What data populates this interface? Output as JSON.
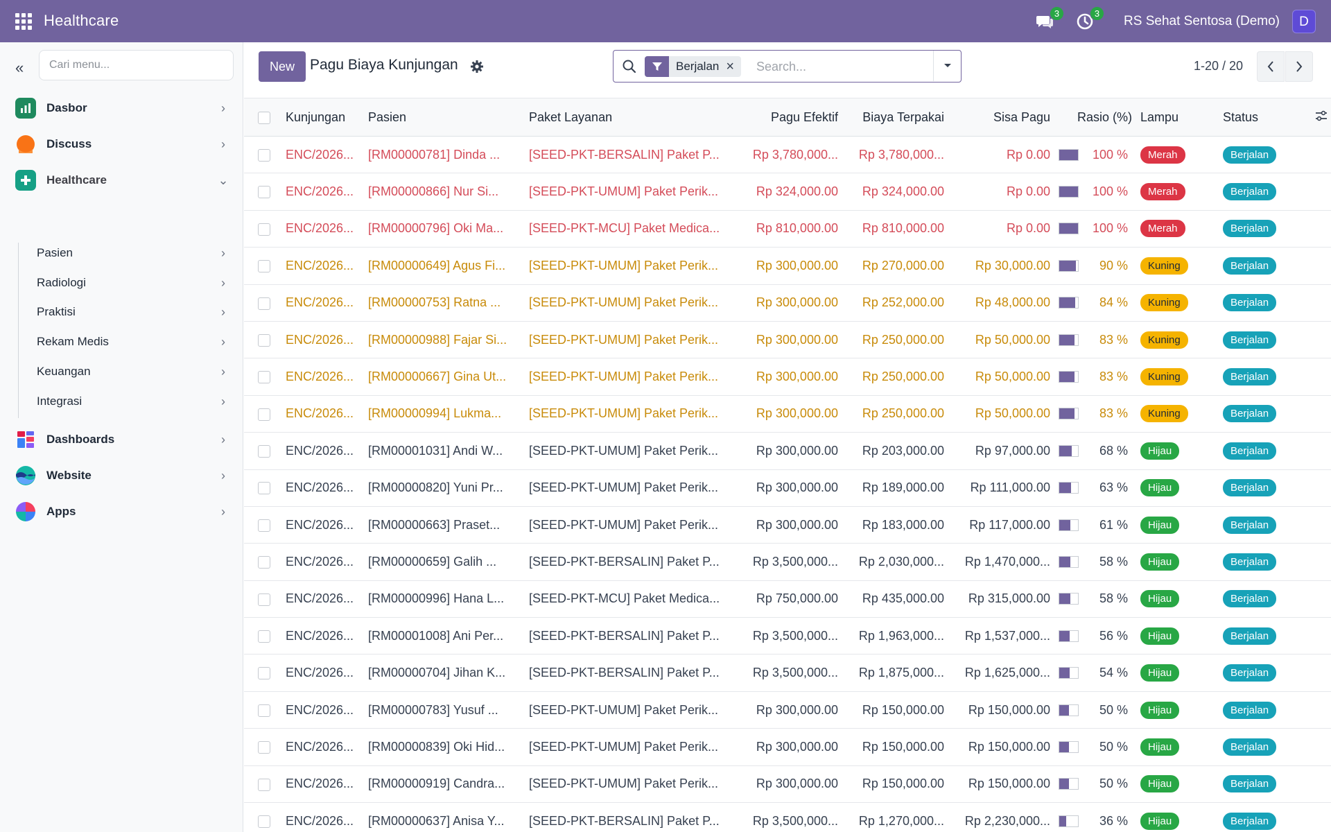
{
  "topbar": {
    "brand": "Healthcare",
    "chat_count": "3",
    "activity_count": "3",
    "company": "RS Sehat Sentosa (Demo)",
    "avatar_initial": "D",
    "color": "#71639e"
  },
  "sidebar": {
    "collapse_glyph": "«",
    "search_placeholder": "Cari menu...",
    "items": [
      {
        "label": "Dasbor",
        "icon": "bar-chart-icon"
      },
      {
        "label": "Discuss",
        "icon": "discuss-icon"
      },
      {
        "label": "Healthcare",
        "icon": "healthcare-cross-icon"
      },
      {
        "label": "Dashboards",
        "icon": "dashboards-icon"
      },
      {
        "label": "Website",
        "icon": "website-icon"
      },
      {
        "label": "Apps",
        "icon": "apps-icon"
      }
    ],
    "sub_items": [
      {
        "label": "Pasien"
      },
      {
        "label": "Radiologi"
      },
      {
        "label": "Praktisi"
      },
      {
        "label": "Rekam Medis"
      },
      {
        "label": "Keuangan"
      },
      {
        "label": "Integrasi"
      }
    ]
  },
  "control": {
    "new_label": "New",
    "title": "Pagu Biaya Kunjungan",
    "facet_label": "Berjalan",
    "search_placeholder": "Search...",
    "pager": "1-20 / 20"
  },
  "table": {
    "headers": {
      "kunjungan": "Kunjungan",
      "pasien": "Pasien",
      "paket": "Paket Layanan",
      "pagu": "Pagu Efektif",
      "biaya": "Biaya Terpakai",
      "sisa": "Sisa Pagu",
      "rasio": "Rasio (%)",
      "lampu": "Lampu",
      "status": "Status"
    },
    "rows": [
      {
        "kunjungan": "ENC/2026...",
        "pasien": "[RM00000781] Dinda ...",
        "paket": "[SEED-PKT-BERSALIN] Paket P...",
        "pagu": "Rp 3,780,000...",
        "biaya": "Rp 3,780,000...",
        "sisa": "Rp 0.00",
        "rasio": "100 %",
        "rasio_value": 100,
        "lampu": "Merah",
        "status": "Berjalan",
        "tone": "danger"
      },
      {
        "kunjungan": "ENC/2026...",
        "pasien": "[RM00000866] Nur Si...",
        "paket": "[SEED-PKT-UMUM] Paket Perik...",
        "pagu": "Rp 324,000.00",
        "biaya": "Rp 324,000.00",
        "sisa": "Rp 0.00",
        "rasio": "100 %",
        "rasio_value": 100,
        "lampu": "Merah",
        "status": "Berjalan",
        "tone": "danger"
      },
      {
        "kunjungan": "ENC/2026...",
        "pasien": "[RM00000796] Oki Ma...",
        "paket": "[SEED-PKT-MCU] Paket Medica...",
        "pagu": "Rp 810,000.00",
        "biaya": "Rp 810,000.00",
        "sisa": "Rp 0.00",
        "rasio": "100 %",
        "rasio_value": 100,
        "lampu": "Merah",
        "status": "Berjalan",
        "tone": "danger"
      },
      {
        "kunjungan": "ENC/2026...",
        "pasien": "[RM00000649] Agus Fi...",
        "paket": "[SEED-PKT-UMUM] Paket Perik...",
        "pagu": "Rp 300,000.00",
        "biaya": "Rp 270,000.00",
        "sisa": "Rp 30,000.00",
        "rasio": "90 %",
        "rasio_value": 90,
        "lampu": "Kuning",
        "status": "Berjalan",
        "tone": "warning"
      },
      {
        "kunjungan": "ENC/2026...",
        "pasien": "[RM00000753] Ratna ...",
        "paket": "[SEED-PKT-UMUM] Paket Perik...",
        "pagu": "Rp 300,000.00",
        "biaya": "Rp 252,000.00",
        "sisa": "Rp 48,000.00",
        "rasio": "84 %",
        "rasio_value": 84,
        "lampu": "Kuning",
        "status": "Berjalan",
        "tone": "warning"
      },
      {
        "kunjungan": "ENC/2026...",
        "pasien": "[RM00000988] Fajar Si...",
        "paket": "[SEED-PKT-UMUM] Paket Perik...",
        "pagu": "Rp 300,000.00",
        "biaya": "Rp 250,000.00",
        "sisa": "Rp 50,000.00",
        "rasio": "83 %",
        "rasio_value": 83,
        "lampu": "Kuning",
        "status": "Berjalan",
        "tone": "warning"
      },
      {
        "kunjungan": "ENC/2026...",
        "pasien": "[RM00000667] Gina Ut...",
        "paket": "[SEED-PKT-UMUM] Paket Perik...",
        "pagu": "Rp 300,000.00",
        "biaya": "Rp 250,000.00",
        "sisa": "Rp 50,000.00",
        "rasio": "83 %",
        "rasio_value": 83,
        "lampu": "Kuning",
        "status": "Berjalan",
        "tone": "warning"
      },
      {
        "kunjungan": "ENC/2026...",
        "pasien": "[RM00000994] Lukma...",
        "paket": "[SEED-PKT-UMUM] Paket Perik...",
        "pagu": "Rp 300,000.00",
        "biaya": "Rp 250,000.00",
        "sisa": "Rp 50,000.00",
        "rasio": "83 %",
        "rasio_value": 83,
        "lampu": "Kuning",
        "status": "Berjalan",
        "tone": "warning"
      },
      {
        "kunjungan": "ENC/2026...",
        "pasien": "[RM00001031] Andi W...",
        "paket": "[SEED-PKT-UMUM] Paket Perik...",
        "pagu": "Rp 300,000.00",
        "biaya": "Rp 203,000.00",
        "sisa": "Rp 97,000.00",
        "rasio": "68 %",
        "rasio_value": 68,
        "lampu": "Hijau",
        "status": "Berjalan",
        "tone": "normal"
      },
      {
        "kunjungan": "ENC/2026...",
        "pasien": "[RM00000820] Yuni Pr...",
        "paket": "[SEED-PKT-UMUM] Paket Perik...",
        "pagu": "Rp 300,000.00",
        "biaya": "Rp 189,000.00",
        "sisa": "Rp 111,000.00",
        "rasio": "63 %",
        "rasio_value": 63,
        "lampu": "Hijau",
        "status": "Berjalan",
        "tone": "normal"
      },
      {
        "kunjungan": "ENC/2026...",
        "pasien": "[RM00000663] Praset...",
        "paket": "[SEED-PKT-UMUM] Paket Perik...",
        "pagu": "Rp 300,000.00",
        "biaya": "Rp 183,000.00",
        "sisa": "Rp 117,000.00",
        "rasio": "61 %",
        "rasio_value": 61,
        "lampu": "Hijau",
        "status": "Berjalan",
        "tone": "normal"
      },
      {
        "kunjungan": "ENC/2026...",
        "pasien": "[RM00000659] Galih ...",
        "paket": "[SEED-PKT-BERSALIN] Paket P...",
        "pagu": "Rp 3,500,000...",
        "biaya": "Rp 2,030,000...",
        "sisa": "Rp 1,470,000...",
        "rasio": "58 %",
        "rasio_value": 58,
        "lampu": "Hijau",
        "status": "Berjalan",
        "tone": "normal"
      },
      {
        "kunjungan": "ENC/2026...",
        "pasien": "[RM00000996] Hana L...",
        "paket": "[SEED-PKT-MCU] Paket Medica...",
        "pagu": "Rp 750,000.00",
        "biaya": "Rp 435,000.00",
        "sisa": "Rp 315,000.00",
        "rasio": "58 %",
        "rasio_value": 58,
        "lampu": "Hijau",
        "status": "Berjalan",
        "tone": "normal"
      },
      {
        "kunjungan": "ENC/2026...",
        "pasien": "[RM00001008] Ani Per...",
        "paket": "[SEED-PKT-BERSALIN] Paket P...",
        "pagu": "Rp 3,500,000...",
        "biaya": "Rp 1,963,000...",
        "sisa": "Rp 1,537,000...",
        "rasio": "56 %",
        "rasio_value": 56,
        "lampu": "Hijau",
        "status": "Berjalan",
        "tone": "normal"
      },
      {
        "kunjungan": "ENC/2026...",
        "pasien": "[RM00000704] Jihan K...",
        "paket": "[SEED-PKT-BERSALIN] Paket P...",
        "pagu": "Rp 3,500,000...",
        "biaya": "Rp 1,875,000...",
        "sisa": "Rp 1,625,000...",
        "rasio": "54 %",
        "rasio_value": 54,
        "lampu": "Hijau",
        "status": "Berjalan",
        "tone": "normal"
      },
      {
        "kunjungan": "ENC/2026...",
        "pasien": "[RM00000783] Yusuf ...",
        "paket": "[SEED-PKT-UMUM] Paket Perik...",
        "pagu": "Rp 300,000.00",
        "biaya": "Rp 150,000.00",
        "sisa": "Rp 150,000.00",
        "rasio": "50 %",
        "rasio_value": 50,
        "lampu": "Hijau",
        "status": "Berjalan",
        "tone": "normal"
      },
      {
        "kunjungan": "ENC/2026...",
        "pasien": "[RM00000839] Oki Hid...",
        "paket": "[SEED-PKT-UMUM] Paket Perik...",
        "pagu": "Rp 300,000.00",
        "biaya": "Rp 150,000.00",
        "sisa": "Rp 150,000.00",
        "rasio": "50 %",
        "rasio_value": 50,
        "lampu": "Hijau",
        "status": "Berjalan",
        "tone": "normal"
      },
      {
        "kunjungan": "ENC/2026...",
        "pasien": "[RM00000919] Candra...",
        "paket": "[SEED-PKT-UMUM] Paket Perik...",
        "pagu": "Rp 300,000.00",
        "biaya": "Rp 150,000.00",
        "sisa": "Rp 150,000.00",
        "rasio": "50 %",
        "rasio_value": 50,
        "lampu": "Hijau",
        "status": "Berjalan",
        "tone": "normal"
      },
      {
        "kunjungan": "ENC/2026...",
        "pasien": "[RM00000637] Anisa Y...",
        "paket": "[SEED-PKT-BERSALIN] Paket P...",
        "pagu": "Rp 3,500,000...",
        "biaya": "Rp 1,270,000...",
        "sisa": "Rp 2,230,000...",
        "rasio": "36 %",
        "rasio_value": 36,
        "lampu": "Hijau",
        "status": "Berjalan",
        "tone": "normal"
      }
    ]
  },
  "colors": {
    "accent": "#71639e",
    "danger_text": "#d44c59",
    "warning_text": "#c88b0a",
    "merah": "#dc3545",
    "kuning": "#f5b300",
    "hijau": "#28a745",
    "status": "#17a2b8"
  }
}
